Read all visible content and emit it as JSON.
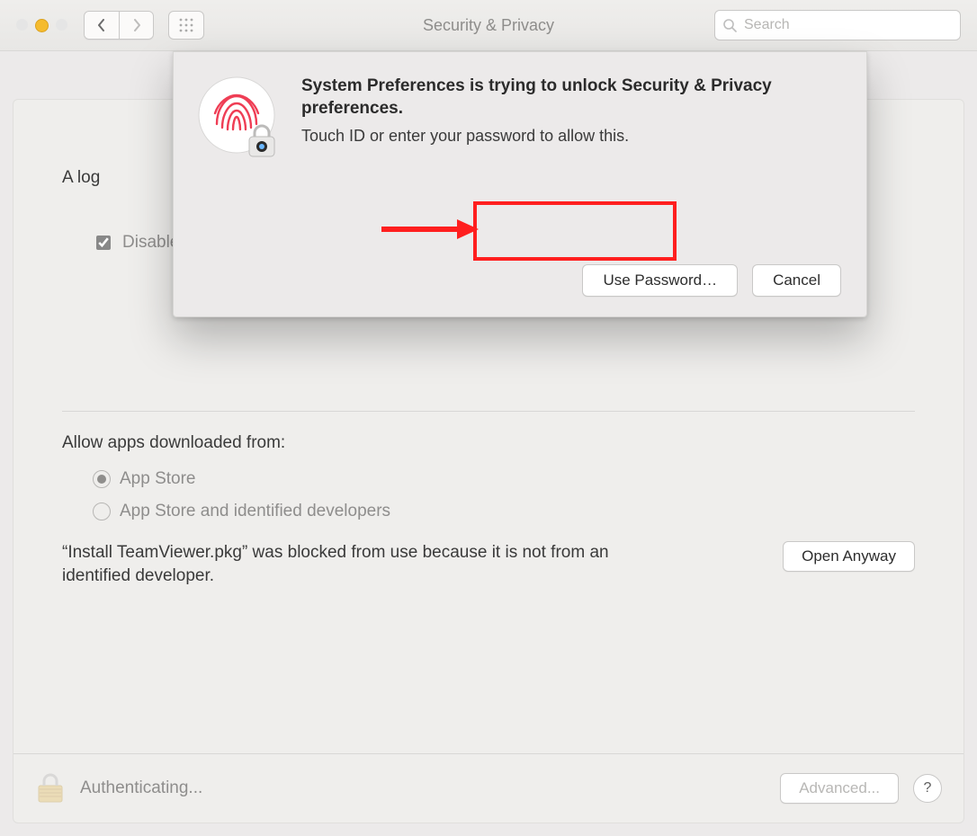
{
  "toolbar": {
    "title": "Security & Privacy",
    "search_placeholder": "Search"
  },
  "main": {
    "login_line": "A log",
    "disable_auto_login": "Disable automatic login",
    "allow_heading": "Allow apps downloaded from:",
    "radio1": "App Store",
    "radio2": "App Store and identified developers",
    "blocked_text": "“Install TeamViewer.pkg” was blocked from use because it is not from an identified developer.",
    "open_anyway": "Open Anyway"
  },
  "footer": {
    "auth_text": "Authenticating...",
    "advanced_label": "Advanced...",
    "help_label": "?"
  },
  "dialog": {
    "title": "System Preferences is trying to unlock Security & Privacy preferences.",
    "subtitle": "Touch ID or enter your password to allow this.",
    "use_password": "Use Password…",
    "cancel": "Cancel"
  }
}
